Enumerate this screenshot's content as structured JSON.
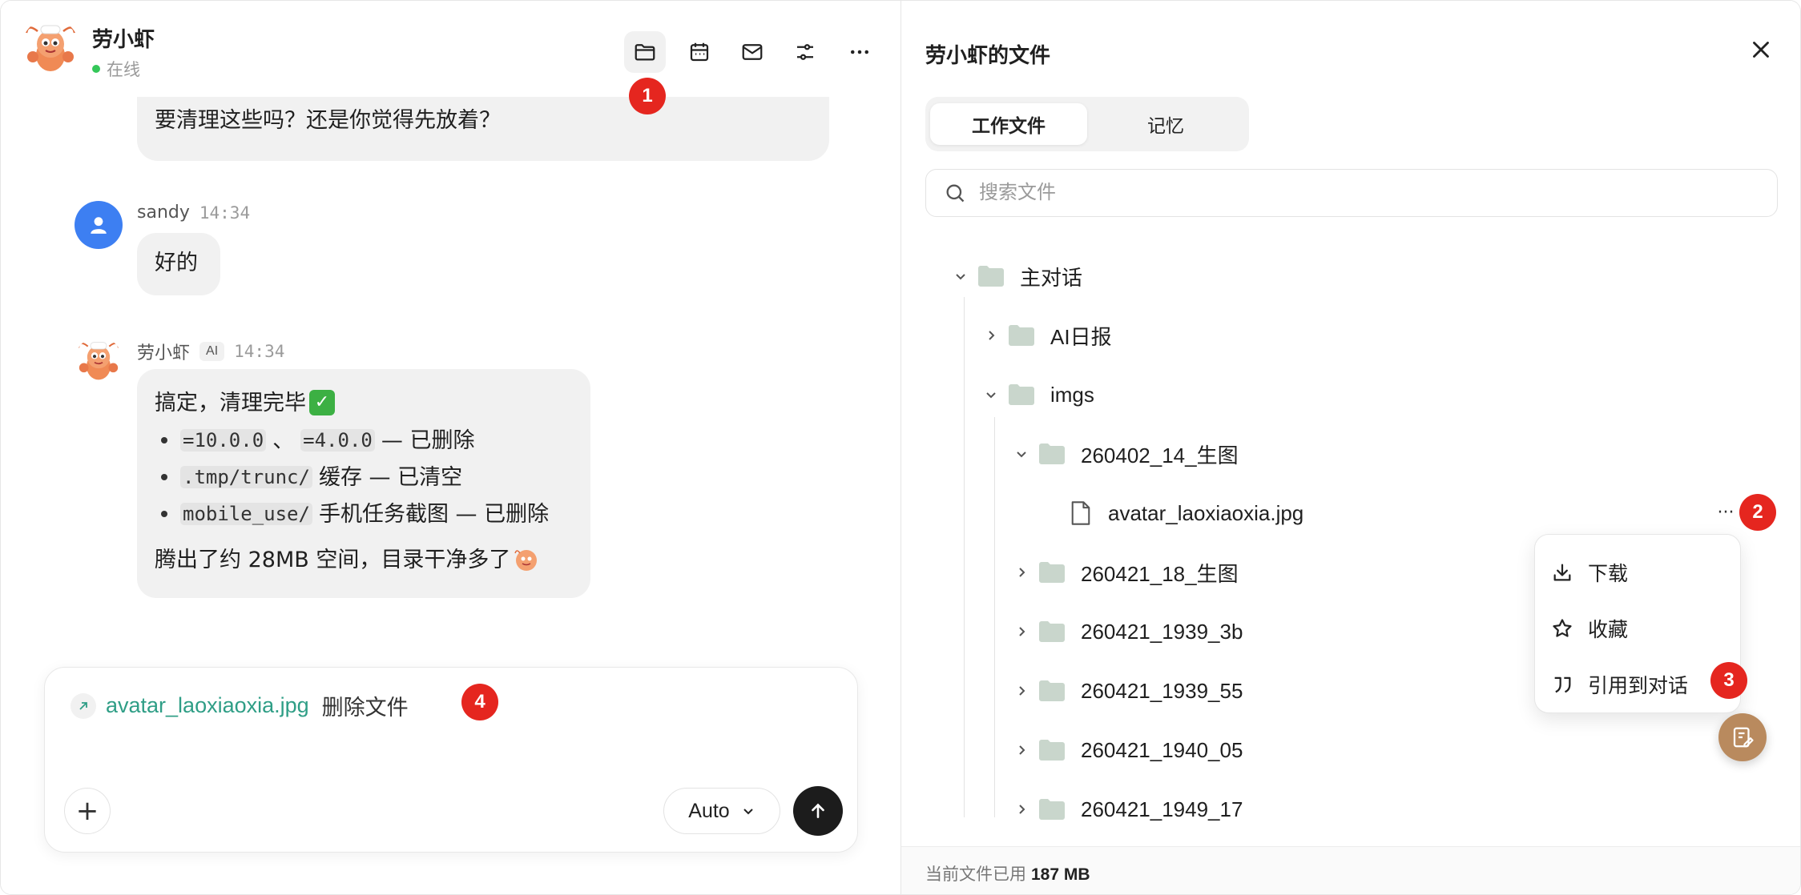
{
  "chat": {
    "agent_name": "劳小虾",
    "status": "在线",
    "header_icons": [
      "folder-icon",
      "calendar-icon",
      "mail-icon",
      "sliders-icon",
      "more-icon"
    ],
    "messages": {
      "prev_ai_tail": "要清理这些吗？还是你觉得先放着？",
      "user": {
        "name": "sandy",
        "time": "14:34",
        "text": "好的"
      },
      "ai": {
        "name": "劳小虾",
        "tag": "AI",
        "time": "14:34",
        "intro": "搞定，清理完毕",
        "items": [
          {
            "code": "=10.0.0",
            "sep": "、",
            "code2": "=4.0.0",
            "text": " — 已删除"
          },
          {
            "code": ".tmp/trunc/",
            "text": " 缓存 — 已清空"
          },
          {
            "code": "mobile_use/",
            "text": " 手机任务截图 — 已删除"
          }
        ],
        "summary": "腾出了约 28MB 空间，目录干净多了"
      }
    },
    "composer": {
      "ref_file": "avatar_laoxiaoxia.jpg",
      "ref_text": "删除文件",
      "model": "Auto",
      "plus_label": "+"
    }
  },
  "files": {
    "title": "劳小虾的文件",
    "tabs": [
      {
        "label": "工作文件",
        "active": true
      },
      {
        "label": "记忆",
        "active": false
      }
    ],
    "search_placeholder": "搜索文件",
    "tree": [
      {
        "label": "主对话",
        "type": "folder",
        "expanded": true,
        "depth": 0
      },
      {
        "label": "AI日报",
        "type": "folder",
        "expanded": false,
        "depth": 1
      },
      {
        "label": "imgs",
        "type": "folder",
        "expanded": true,
        "depth": 1
      },
      {
        "label": "260402_14_生图",
        "type": "folder",
        "expanded": true,
        "depth": 2
      },
      {
        "label": "avatar_laoxiaoxia.jpg",
        "type": "file",
        "depth": 3
      },
      {
        "label": "260421_18_生图",
        "type": "folder",
        "expanded": false,
        "depth": 2
      },
      {
        "label": "260421_1939_3b",
        "type": "folder",
        "expanded": false,
        "depth": 2
      },
      {
        "label": "260421_1939_55",
        "type": "folder",
        "expanded": false,
        "depth": 2
      },
      {
        "label": "260421_1940_05",
        "type": "folder",
        "expanded": false,
        "depth": 2
      },
      {
        "label": "260421_1949_17",
        "type": "folder",
        "expanded": false,
        "depth": 2
      }
    ],
    "row_more": "···",
    "context_menu": [
      {
        "label": "下载",
        "icon": "download-icon"
      },
      {
        "label": "收藏",
        "icon": "star-icon"
      },
      {
        "label": "引用到对话",
        "icon": "quote-icon"
      }
    ],
    "footer_label": "当前文件已用",
    "footer_value": "187 MB"
  },
  "badges": [
    "1",
    "2",
    "3",
    "4"
  ],
  "colors": {
    "accent_green": "#2f9e86",
    "badge_red": "#e5261f",
    "user_avatar_blue": "#3d7ff2",
    "folder_green": "#c9d6cc",
    "fab_brown": "#b98a5e"
  }
}
